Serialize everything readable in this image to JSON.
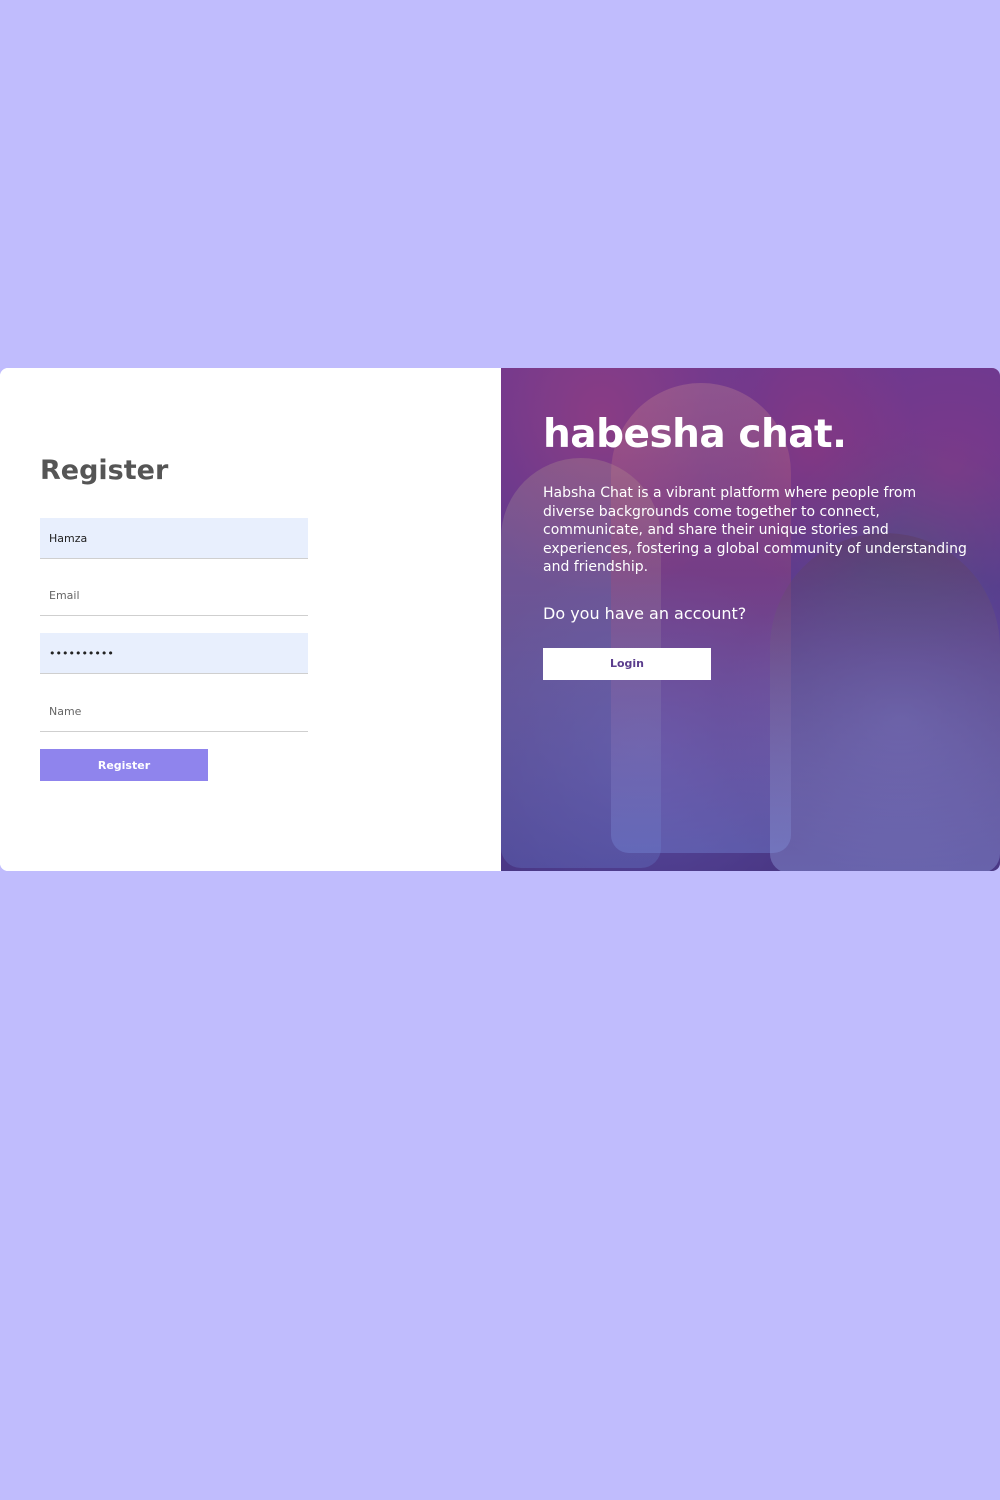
{
  "register": {
    "title": "Register",
    "fields": {
      "name_first": {
        "value": "Hamza",
        "placeholder": ""
      },
      "email": {
        "value": "",
        "placeholder": "Email"
      },
      "password": {
        "value": "••••••••••",
        "placeholder": ""
      },
      "name_second": {
        "value": "",
        "placeholder": "Name"
      }
    },
    "button_label": "Register"
  },
  "intro": {
    "title": "habesha chat.",
    "description": "Habsha Chat is a vibrant platform where people from diverse backgrounds come together to connect, communicate, and share their unique stories and experiences, fostering a global community of understanding and friendship.",
    "account_question": "Do you have an account?",
    "login_label": "Login"
  },
  "colors": {
    "page_background": "#c0bcfd",
    "register_button": "#8f84ed",
    "filled_field": "#e8effd",
    "login_text": "#5b3d8d"
  }
}
